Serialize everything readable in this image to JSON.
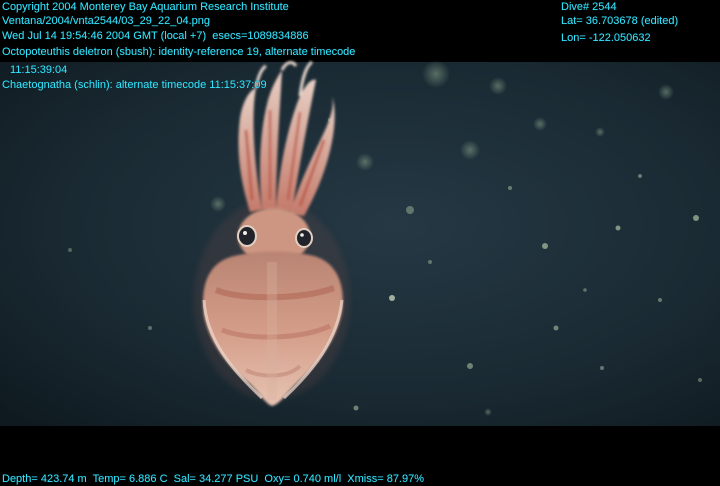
{
  "overlay": {
    "copyright": "Copyright 2004 Monterey Bay Aquarium Research Institute",
    "file_path": "Ventana/2004/vnta2544/03_29_22_04.png",
    "datetime": "Wed Jul 14 19:54:46 2004 GMT (local +7)  esecs=1089834886",
    "annotation_1": "Octopoteuthis deletron (sbush): identity-reference 19, alternate timecode",
    "annotation_1_timecode": "11:15:39:04",
    "annotation_2": "Chaetognatha (schlin): alternate timecode 11:15:37:09",
    "dive": "Dive# 2544",
    "lat": "Lat= 36.703678 (edited)",
    "lon": "Lon= -122.050632",
    "sensors": "Depth= 423.74 m  Temp= 6.886 C  Sal= 34.277 PSU  Oxy= 0.740 ml/l  Xmiss= 87.97%"
  },
  "colors": {
    "overlay_text": "#33e6ff",
    "water": "#1b2a33",
    "squid": "#c98a7a"
  }
}
